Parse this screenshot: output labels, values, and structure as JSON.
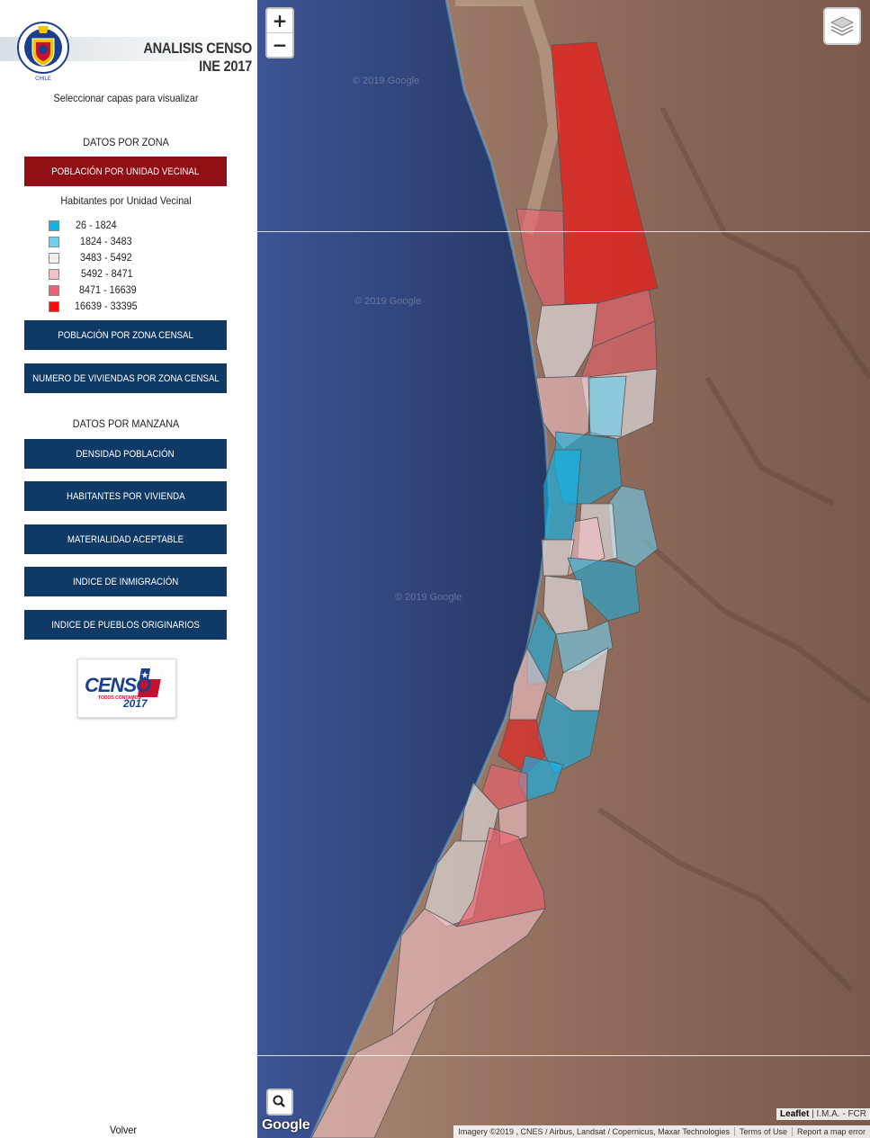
{
  "header": {
    "title": "ANALISIS CENSO INE 2017",
    "logo_ring_text": "MUNICIPALIDAD DE ANTOFAGASTA",
    "logo_bottom_text": "CHILE"
  },
  "sidebar": {
    "prompt": "Seleccionar capas para visualizar",
    "zone_section": "DATOS POR ZONA",
    "zone_buttons": [
      {
        "label": "POBLACIÓN POR UNIDAD VECINAL"
      },
      {
        "label": "POBLACIÓN POR ZONA CENSAL"
      },
      {
        "label": "NUMERO DE VIVIENDAS POR ZONA CENSAL"
      }
    ],
    "legend_title": "Habitantes por Unidad Vecinal",
    "legend": [
      {
        "label": "26 - 1824",
        "color": "#13b2e6"
      },
      {
        "label": "1824 - 3483",
        "color": "#6fd0f0"
      },
      {
        "label": "3483 - 5492",
        "color": "#eceff3"
      },
      {
        "label": "5492 - 8471",
        "color": "#f3c2c8"
      },
      {
        "label": "8471 - 16639",
        "color": "#f06070"
      },
      {
        "label": "16639 - 33395",
        "color": "#ff0a0a"
      }
    ],
    "block_section": "DATOS POR MANZANA",
    "block_buttons": [
      {
        "label": "DENSIDAD POBLACIÓN"
      },
      {
        "label": "HABITANTES POR VIVIENDA"
      },
      {
        "label": "MATERIALIDAD ACEPTABLE"
      },
      {
        "label": "INDICE DE INMIGRACIÓN"
      },
      {
        "label": "INDICE DE PUEBLOS ORIGINARIOS"
      }
    ],
    "censo_logo": {
      "word": "CENSO",
      "tag": "TODOS CONTAMOS",
      "year": "2017"
    },
    "back_link": "Volver"
  },
  "map": {
    "zoom_in": "+",
    "zoom_out": "−",
    "watermark": "© 2019 Google",
    "google_logo": "Google",
    "attribution_leaflet": "Leaflet",
    "attribution_rest": "| I.M.A. - FCR",
    "imagery": "Imagery ©2019 , CNES / Airbus, Landsat / Copernicus, Maxar Technologies",
    "terms": "Terms of Use",
    "report": "Report a map error",
    "icons": {
      "layers": "layers-icon",
      "search": "search-icon"
    }
  }
}
